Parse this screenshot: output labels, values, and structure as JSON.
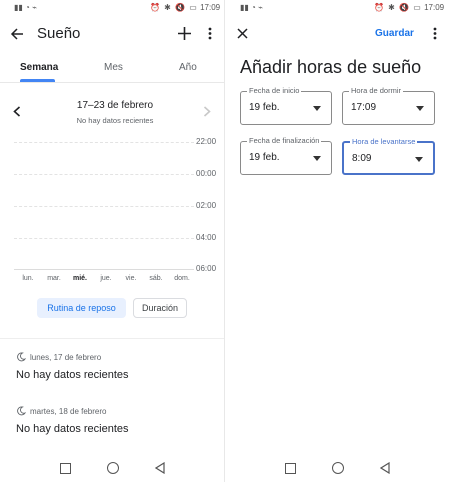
{
  "left": {
    "status_time": "17:09",
    "app_title": "Sueño",
    "tabs": [
      {
        "label": "Semana"
      },
      {
        "label": "Mes"
      },
      {
        "label": "Año"
      }
    ],
    "week_range": "17–23 de febrero",
    "no_data_label": "No hay datos recientes",
    "time_labels": [
      "22:00",
      "00:00",
      "02:00",
      "04:00",
      "06:00"
    ],
    "days": [
      "lun.",
      "mar.",
      "mié.",
      "jue.",
      "vie.",
      "sáb.",
      "dom."
    ],
    "active_day_index": 2,
    "chips": {
      "primary": "Rutina de reposo",
      "secondary": "Duración"
    },
    "entries": [
      {
        "date": "lunes, 17 de febrero",
        "status": "No hay datos recientes"
      },
      {
        "date": "martes, 18 de febrero",
        "status": "No hay datos recientes"
      }
    ]
  },
  "right": {
    "status_time": "17:09",
    "save_label": "Guardar",
    "heading": "Añadir horas de sueño",
    "fields": {
      "start_date_label": "Fecha de inicio",
      "start_date_value": "19 feb.",
      "bed_time_label": "Hora de dormir",
      "bed_time_value": "17:09",
      "end_date_label": "Fecha de finalización",
      "end_date_value": "19 feb.",
      "wake_time_label": "Hora de levantarse",
      "wake_time_value": "8:09"
    }
  },
  "colors": {
    "accent": "#4285f4",
    "chip_bg": "#e8f0fe",
    "chip_text": "#1a73e8",
    "focus": "#4a73c9"
  }
}
